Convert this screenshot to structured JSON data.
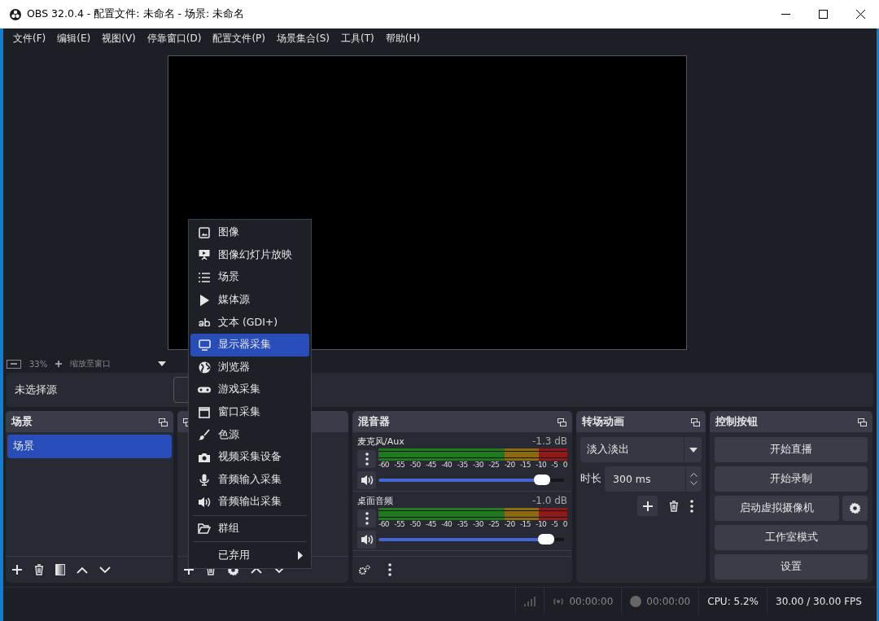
{
  "window": {
    "title": "OBS 32.0.4 - 配置文件: 未命名 - 场景: 未命名"
  },
  "menu_bar": [
    "文件(F)",
    "编辑(E)",
    "视图(V)",
    "停靠窗口(D)",
    "配置文件(P)",
    "场景集合(S)",
    "工具(T)",
    "帮助(H)"
  ],
  "preview": {
    "zoom": "33%",
    "zoom_mode": "缩放至窗口"
  },
  "source_bar": {
    "text": "未选择源"
  },
  "scenes": {
    "title": "场景",
    "items": [
      {
        "label": "场景",
        "selected": true
      }
    ]
  },
  "mixer": {
    "title": "混音器",
    "channels": [
      {
        "name": "麦克风/Aux",
        "reading": "-1.3 dB",
        "level": 0.9,
        "scale": [
          "-60",
          "-55",
          "-50",
          "-45",
          "-40",
          "-35",
          "-30",
          "-25",
          "-20",
          "-15",
          "-10",
          "-5",
          "0"
        ]
      },
      {
        "name": "桌面音频",
        "reading": "-1.0 dB",
        "level": 0.92,
        "scale": [
          "-60",
          "-55",
          "-50",
          "-45",
          "-40",
          "-35",
          "-30",
          "-25",
          "-20",
          "-15",
          "-10",
          "-5",
          "0"
        ]
      }
    ]
  },
  "transitions": {
    "title": "转场动画",
    "transition": "淡入淡出",
    "duration_label": "时长",
    "duration": "300 ms"
  },
  "controls": {
    "title": "控制按钮",
    "buttons": [
      {
        "label": "开始直播",
        "kind": "plain"
      },
      {
        "label": "开始录制",
        "kind": "plain"
      },
      {
        "label": "启动虚拟摄像机",
        "kind": "with-settings"
      },
      {
        "label": "工作室模式",
        "kind": "plain"
      },
      {
        "label": "设置",
        "kind": "plain"
      }
    ]
  },
  "status_bar": {
    "stream_time": "00:00:00",
    "record_time": "00:00:00",
    "cpu": "CPU: 5.2%",
    "fps": "30.00 / 30.00 FPS"
  },
  "context_menu": {
    "items": [
      {
        "label": "图像",
        "kind": "source",
        "selected": false
      },
      {
        "label": "图像幻灯片放映",
        "kind": "source",
        "selected": false
      },
      {
        "label": "场景",
        "kind": "source",
        "selected": false
      },
      {
        "label": "媒体源",
        "kind": "source",
        "selected": false
      },
      {
        "label": "文本 (GDI+)",
        "kind": "source",
        "selected": false
      },
      {
        "label": "显示器采集",
        "kind": "source",
        "selected": true
      },
      {
        "label": "浏览器",
        "kind": "source",
        "selected": false
      },
      {
        "label": "游戏采集",
        "kind": "source",
        "selected": false
      },
      {
        "label": "窗口采集",
        "kind": "source",
        "selected": false
      },
      {
        "label": "色源",
        "kind": "source",
        "selected": false
      },
      {
        "label": "视频采集设备",
        "kind": "source",
        "selected": false
      },
      {
        "label": "音频输入采集",
        "kind": "source",
        "selected": false
      },
      {
        "label": "音频输出采集",
        "kind": "source",
        "selected": false
      },
      {
        "label": "群组",
        "kind": "group",
        "selected": false
      },
      {
        "label": "已弃用",
        "kind": "submenu",
        "selected": false
      }
    ]
  }
}
